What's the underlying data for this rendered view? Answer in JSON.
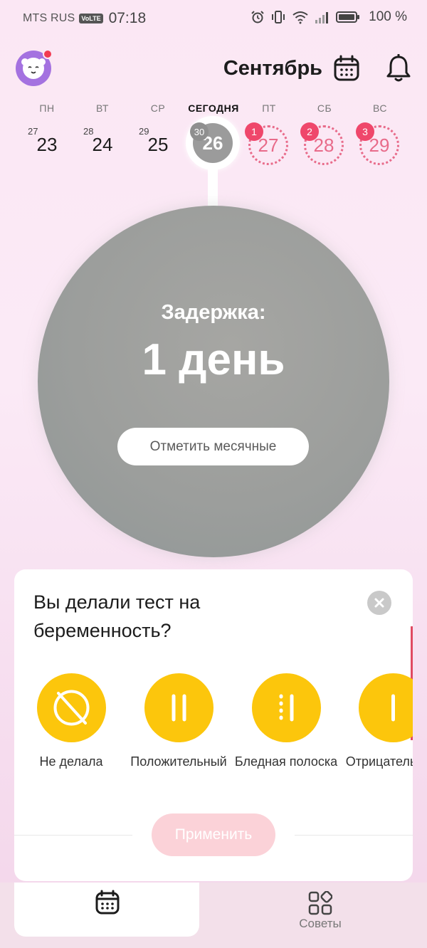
{
  "status_bar": {
    "carrier": "MTS RUS",
    "volte": "VoLTE",
    "time": "07:18",
    "battery": "100 %"
  },
  "header": {
    "month": "Сентябрь"
  },
  "week": {
    "days": [
      {
        "name": "ПН",
        "prev": "27",
        "num": "23"
      },
      {
        "name": "ВТ",
        "prev": "28",
        "num": "24"
      },
      {
        "name": "СР",
        "prev": "29",
        "num": "25"
      },
      {
        "name": "СЕГОДНЯ",
        "prev": "30",
        "num": "26"
      },
      {
        "name": "ПТ",
        "badge": "1",
        "num": "27"
      },
      {
        "name": "СБ",
        "badge": "2",
        "num": "28"
      },
      {
        "name": "ВС",
        "badge": "3",
        "num": "29"
      }
    ]
  },
  "main": {
    "delay_label": "Задержка:",
    "delay_value": "1 день",
    "mark_button": "Отметить месячные"
  },
  "sheet": {
    "title": "Вы делали тест на беременность?",
    "options": [
      {
        "label": "Не делала",
        "icon": "no-test-icon"
      },
      {
        "label": "Положительный",
        "icon": "two-lines-icon"
      },
      {
        "label": "Бледная полоска",
        "icon": "faint-line-icon"
      },
      {
        "label": "Отрицательный",
        "icon": "one-line-icon"
      }
    ],
    "apply_button": "Применить"
  },
  "nav": {
    "calendar_icon": "calendar-icon",
    "tips_label": "Советы"
  },
  "colors": {
    "accent_pink": "#ef476b",
    "option_yellow": "#fcc60c",
    "avatar_purple": "#a472e0"
  }
}
